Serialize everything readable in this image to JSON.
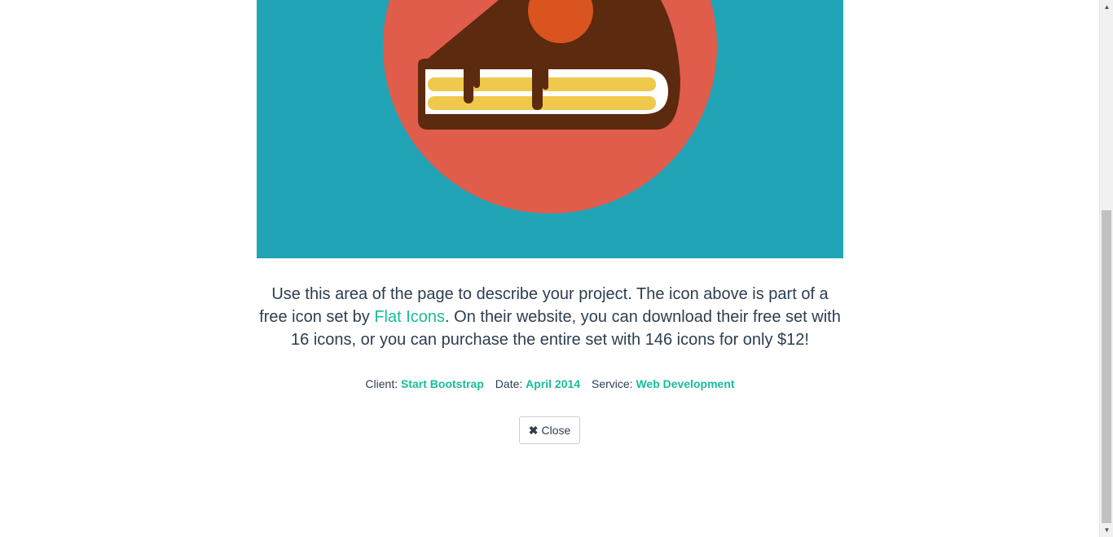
{
  "project": {
    "image_alt": "Cake",
    "description_before": "Use this area of the page to describe your project. The icon above is part of a free icon set by ",
    "link_text": "Flat Icons",
    "description_after": ". On their website, you can download their free set with 16 icons, or you can purchase the entire set with 146 icons for only $12!"
  },
  "meta": {
    "client_label": "Client:",
    "client_value": "Start Bootstrap",
    "date_label": "Date:",
    "date_value": "April 2014",
    "service_label": "Service:",
    "service_value": "Web Development"
  },
  "close_button": {
    "label": "Close",
    "icon": "times-icon"
  },
  "colors": {
    "image_background": "#21a4b6",
    "circle": "#e05c4b",
    "cake_chocolate": "#5c2a0e",
    "cake_layer": "#f0c84c",
    "cherry": "#d9541e",
    "link": "#18bc9c",
    "text": "#2c3e50"
  },
  "scrollbar": {
    "up_icon": "arrow-up-icon",
    "down_icon": "arrow-down-icon"
  }
}
